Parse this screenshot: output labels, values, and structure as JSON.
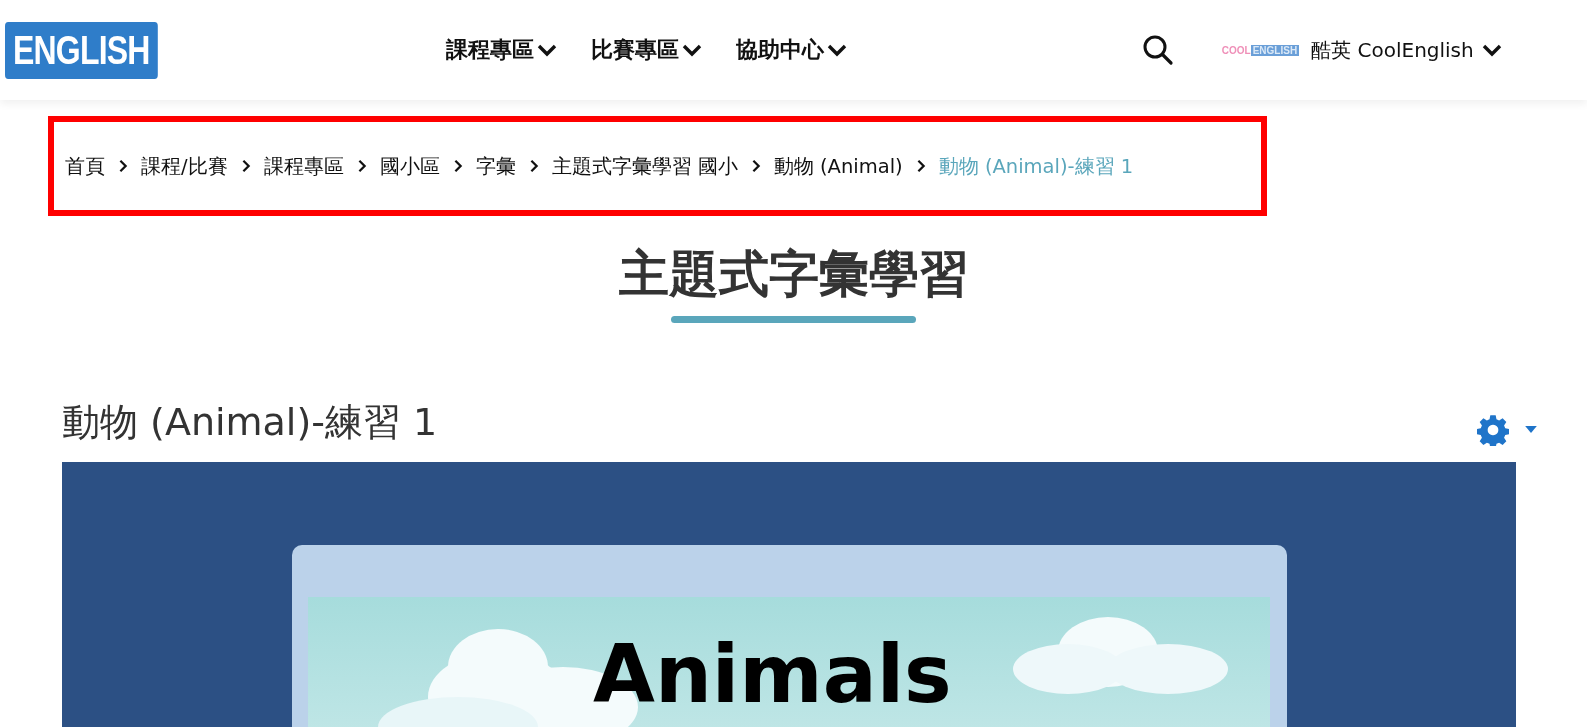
{
  "header": {
    "logo": "ENGLISH",
    "nav": [
      {
        "label": "課程專區"
      },
      {
        "label": "比賽專區"
      },
      {
        "label": "協助中心"
      }
    ],
    "site_badge": {
      "left": "COOL",
      "right": "ENGLISH"
    },
    "user_menu": "酷英 CoolEnglish"
  },
  "breadcrumb": [
    {
      "label": "首頁",
      "selected": false
    },
    {
      "label": "課程/比賽",
      "selected": false
    },
    {
      "label": "課程專區",
      "selected": false
    },
    {
      "label": "國小區",
      "selected": false
    },
    {
      "label": "字彙",
      "selected": false
    },
    {
      "label": "主題式字彙學習 國小",
      "selected": false
    },
    {
      "label": "動物 (Animal)",
      "selected": false
    },
    {
      "label": "動物 (Animal)-練習 1",
      "selected": true
    }
  ],
  "page_title": "主題式字彙學習",
  "activity": {
    "title": "動物 (Animal)-練習 1",
    "game_title": "Animals"
  }
}
